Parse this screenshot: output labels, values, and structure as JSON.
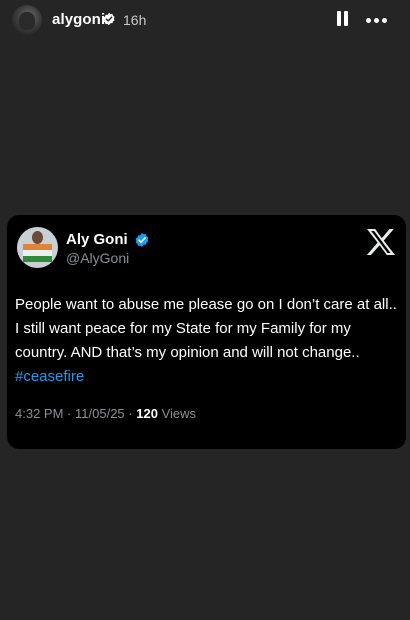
{
  "header": {
    "username": "alygoni",
    "time_ago": "16h",
    "icons": {
      "verified": "verified-badge-icon",
      "pause": "pause-icon",
      "more": "more-horizontal-icon"
    }
  },
  "tweet": {
    "display_name": "Aly Goni",
    "handle": "@AlyGoni",
    "text_before_hashtag": "People want to abuse me please go on I don’t care at all.. I still want peace for my State for my Family for my country. AND that’s my opinion and will not change.. ",
    "hashtag": "#ceasefire",
    "time": "4:32 PM",
    "date": "11/05/25",
    "separator": "·",
    "views_count": "120",
    "views_label": "Views",
    "colors": {
      "background": "#000000",
      "verified_blue": "#1d9bf0",
      "hashtag": "#1d9bf0",
      "secondary_text": "#8b8f94"
    },
    "icons": {
      "verified": "verified-badge-icon",
      "platform": "x-logo-icon"
    }
  },
  "theme": {
    "story_background": "#252525"
  }
}
